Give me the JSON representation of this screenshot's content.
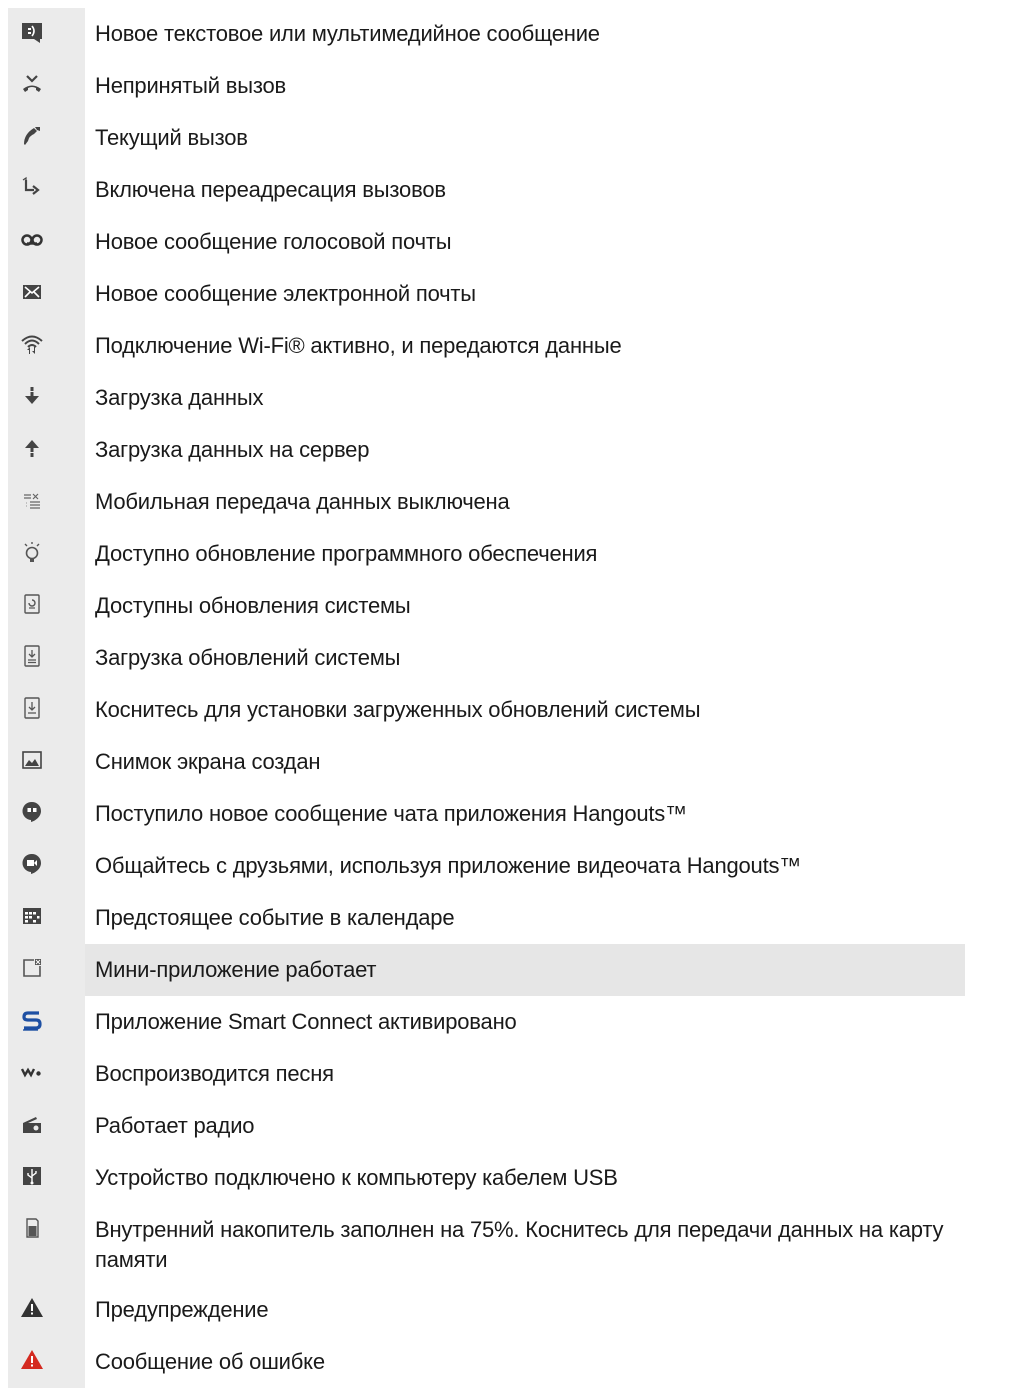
{
  "items": [
    {
      "icon": "message-icon",
      "label": "Новое текстовое или мультимедийное сообщение"
    },
    {
      "icon": "missed-call-icon",
      "label": "Непринятый вызов"
    },
    {
      "icon": "call-icon",
      "label": "Текущий вызов"
    },
    {
      "icon": "call-forward-icon",
      "label": "Включена переадресация вызовов"
    },
    {
      "icon": "voicemail-icon",
      "label": "Новое сообщение голосовой почты"
    },
    {
      "icon": "email-icon",
      "label": "Новое сообщение электронной почты"
    },
    {
      "icon": "wifi-data-icon",
      "label": "Подключение Wi-Fi® активно, и передаются данные"
    },
    {
      "icon": "download-icon",
      "label": "Загрузка данных"
    },
    {
      "icon": "upload-icon",
      "label": "Загрузка данных на сервер"
    },
    {
      "icon": "mobile-data-off-icon",
      "label": "Мобильная передача данных выключена"
    },
    {
      "icon": "software-update-icon",
      "label": "Доступно обновление программного обеспечения"
    },
    {
      "icon": "system-update-icon",
      "label": "Доступны обновления системы"
    },
    {
      "icon": "system-update-download-icon",
      "label": "Загрузка обновлений системы"
    },
    {
      "icon": "system-update-install-icon",
      "label": "Коснитесь для установки загруженных обновлений системы"
    },
    {
      "icon": "screenshot-icon",
      "label": "Снимок экрана создан"
    },
    {
      "icon": "hangouts-chat-icon",
      "label": "Поступило новое сообщение чата приложения Hangouts™"
    },
    {
      "icon": "hangouts-video-icon",
      "label": "Общайтесь с друзьями, используя приложение видеочата Hangouts™"
    },
    {
      "icon": "calendar-icon",
      "label": "Предстоящее событие в календаре"
    },
    {
      "icon": "small-app-icon",
      "label": "Мини-приложение работает"
    },
    {
      "icon": "smart-connect-icon",
      "label": "Приложение Smart Connect активировано"
    },
    {
      "icon": "walkman-icon",
      "label": "Воспроизводится песня"
    },
    {
      "icon": "radio-icon",
      "label": "Работает радио"
    },
    {
      "icon": "usb-icon",
      "label": "Устройство подключено к компьютеру кабелем USB"
    },
    {
      "icon": "storage-full-icon",
      "label": "Внутренний накопитель заполнен на 75%. Коснитесь для передачи данных на карту памяти"
    },
    {
      "icon": "warning-icon",
      "label": "Предупреждение"
    },
    {
      "icon": "error-icon",
      "label": "Сообщение об ошибке"
    }
  ],
  "colors": {
    "icon_bg": "#ebebeb",
    "highlight_bg": "#e6e6e6",
    "error_red": "#d42a20",
    "smart_connect_blue": "#1d4fa3"
  }
}
